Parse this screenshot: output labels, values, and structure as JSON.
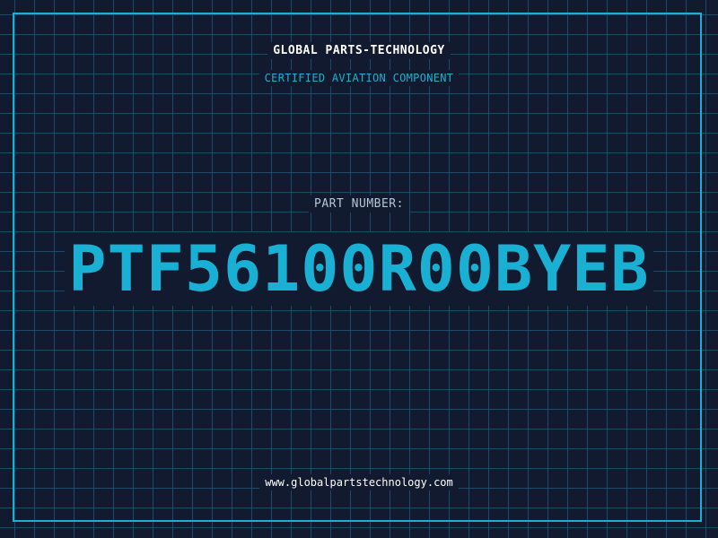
{
  "header": {
    "company": "GLOBAL PARTS-TECHNOLOGY",
    "subtitle": "CERTIFIED AVIATION COMPONENT"
  },
  "part": {
    "label": "PART NUMBER:",
    "number": "PTF56100R00BYEB"
  },
  "footer": {
    "website": "www.globalpartstechnology.com"
  },
  "colors": {
    "background": "#111a2e",
    "grid": "#1d4a68",
    "accent": "#1ab0d3",
    "text": "#ffffff",
    "muted": "#b7c6d6"
  }
}
